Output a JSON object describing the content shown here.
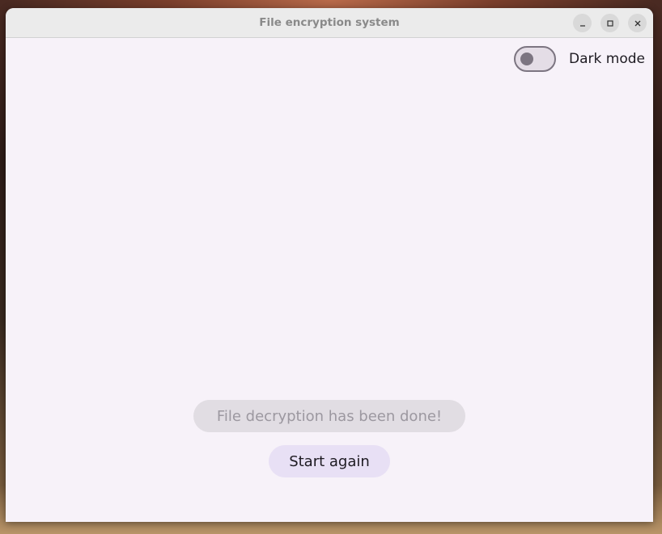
{
  "window": {
    "title": "File encryption system",
    "controls": {
      "minimize_icon": "minimize-icon",
      "maximize_icon": "maximize-icon",
      "close_icon": "close-icon"
    }
  },
  "header": {
    "dark_mode_label": "Dark mode",
    "dark_mode_enabled": false
  },
  "main": {
    "status_text": "File decryption has been done!",
    "start_again_label": "Start again"
  },
  "colors": {
    "window_bg": "#f7f2f9",
    "button_bg": "#e8e0f5",
    "status_bg": "#e1dde3",
    "switch_outline": "#7c7581"
  }
}
